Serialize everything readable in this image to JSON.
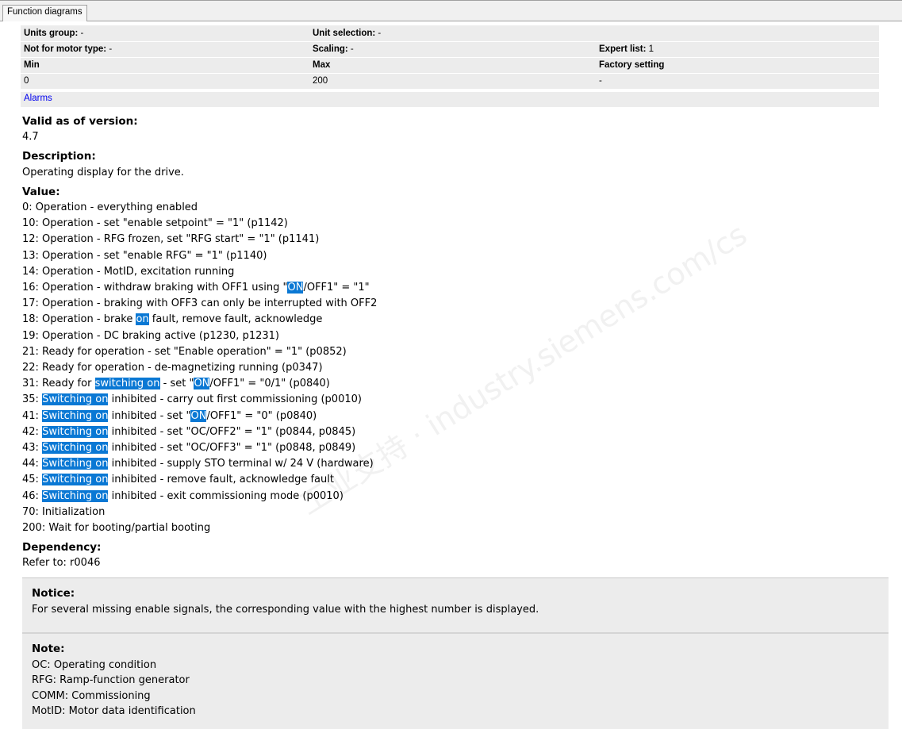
{
  "tab": {
    "label": "Function diagrams"
  },
  "params_table": {
    "rows": [
      {
        "cells": [
          {
            "label": "Units group:",
            "value": " -"
          },
          {
            "label": "Unit selection:",
            "value": " -"
          },
          {
            "label": "",
            "value": ""
          }
        ]
      },
      {
        "cells": [
          {
            "label": "Not for motor type:",
            "value": " -"
          },
          {
            "label": "Scaling:",
            "value": " -"
          },
          {
            "label": "Expert list:",
            "value": " 1"
          }
        ]
      },
      {
        "cells": [
          {
            "label": "Min",
            "value": ""
          },
          {
            "label": "Max",
            "value": ""
          },
          {
            "label": "Factory setting",
            "value": ""
          }
        ]
      },
      {
        "cells": [
          {
            "label": "",
            "value": "0"
          },
          {
            "label": "",
            "value": "200"
          },
          {
            "label": "",
            "value": "-"
          }
        ]
      }
    ],
    "alarms_link": "Alarms"
  },
  "valid_version": {
    "heading": "Valid as of version:",
    "value": "4.7"
  },
  "description": {
    "heading": "Description:",
    "text": "Operating display for the drive."
  },
  "value": {
    "heading": "Value:",
    "lines": [
      [
        {
          "t": "0: Operation - everything enabled"
        }
      ],
      [
        {
          "t": "10: Operation - set \"enable setpoint\" = \"1\" (p1142)"
        }
      ],
      [
        {
          "t": "12: Operation - RFG frozen, set \"RFG start\" = \"1\" (p1141)"
        }
      ],
      [
        {
          "t": "13: Operation - set \"enable RFG\" = \"1\" (p1140)"
        }
      ],
      [
        {
          "t": "14: Operation - MotID, excitation running"
        }
      ],
      [
        {
          "t": "16: Operation - withdraw braking with OFF1 using \""
        },
        {
          "t": "ON",
          "hl": true
        },
        {
          "t": "/OFF1\" = \"1\""
        }
      ],
      [
        {
          "t": "17: Operation - braking with OFF3 can only be interrupted with OFF2"
        }
      ],
      [
        {
          "t": "18: Operation - brake "
        },
        {
          "t": "on",
          "hl": true
        },
        {
          "t": " fault, remove fault, acknowledge"
        }
      ],
      [
        {
          "t": "19: Operation - DC braking active (p1230, p1231)"
        }
      ],
      [
        {
          "t": "21: Ready for operation - set \"Enable operation\" = \"1\" (p0852)"
        }
      ],
      [
        {
          "t": "22: Ready for operation - de-magnetizing running (p0347)"
        }
      ],
      [
        {
          "t": "31: Ready for "
        },
        {
          "t": "switching on",
          "hl": true
        },
        {
          "t": " - set \""
        },
        {
          "t": "ON",
          "hl": true
        },
        {
          "t": "/OFF1\" = \"0/1\" (p0840)"
        }
      ],
      [
        {
          "t": "35: "
        },
        {
          "t": "Switching on",
          "hl": true
        },
        {
          "t": " inhibited - carry out first commissioning (p0010)"
        }
      ],
      [
        {
          "t": "41: "
        },
        {
          "t": "Switching on",
          "hl": true
        },
        {
          "t": " inhibited - set \""
        },
        {
          "t": "ON",
          "hl": true
        },
        {
          "t": "/OFF1\" = \"0\" (p0840)"
        }
      ],
      [
        {
          "t": "42: "
        },
        {
          "t": "Switching on",
          "hl": true
        },
        {
          "t": " inhibited - set \"OC/OFF2\" = \"1\" (p0844, p0845)"
        }
      ],
      [
        {
          "t": "43: "
        },
        {
          "t": "Switching on",
          "hl": true
        },
        {
          "t": " inhibited - set \"OC/OFF3\" = \"1\" (p0848, p0849)"
        }
      ],
      [
        {
          "t": "44: "
        },
        {
          "t": "Switching on",
          "hl": true
        },
        {
          "t": " inhibited - supply STO terminal w/ 24 V (hardware)"
        }
      ],
      [
        {
          "t": "45: "
        },
        {
          "t": "Switching on",
          "hl": true
        },
        {
          "t": " inhibited - remove fault, acknowledge fault"
        }
      ],
      [
        {
          "t": "46: "
        },
        {
          "t": "Switching on",
          "hl": true
        },
        {
          "t": " inhibited - exit commissioning mode (p0010)"
        }
      ],
      [
        {
          "t": "70: Initialization"
        }
      ],
      [
        {
          "t": "200: Wait for booting/partial booting"
        }
      ]
    ]
  },
  "dependency": {
    "heading": "Dependency:",
    "text": "Refer to: r0046"
  },
  "notice": {
    "heading": "Notice:",
    "text": "For several missing enable signals, the corresponding value with the highest number is displayed."
  },
  "note": {
    "heading": "Note:",
    "lines": [
      "OC: Operating condition",
      "RFG: Ramp-function generator",
      "COMM: Commissioning",
      "MotID: Motor data identification"
    ]
  },
  "watermark": "工业支持 · industry.siemens.com/cs",
  "colors": {
    "highlight": "#0a78d4",
    "link": "#0000ee",
    "row_bg": "#ececec"
  }
}
